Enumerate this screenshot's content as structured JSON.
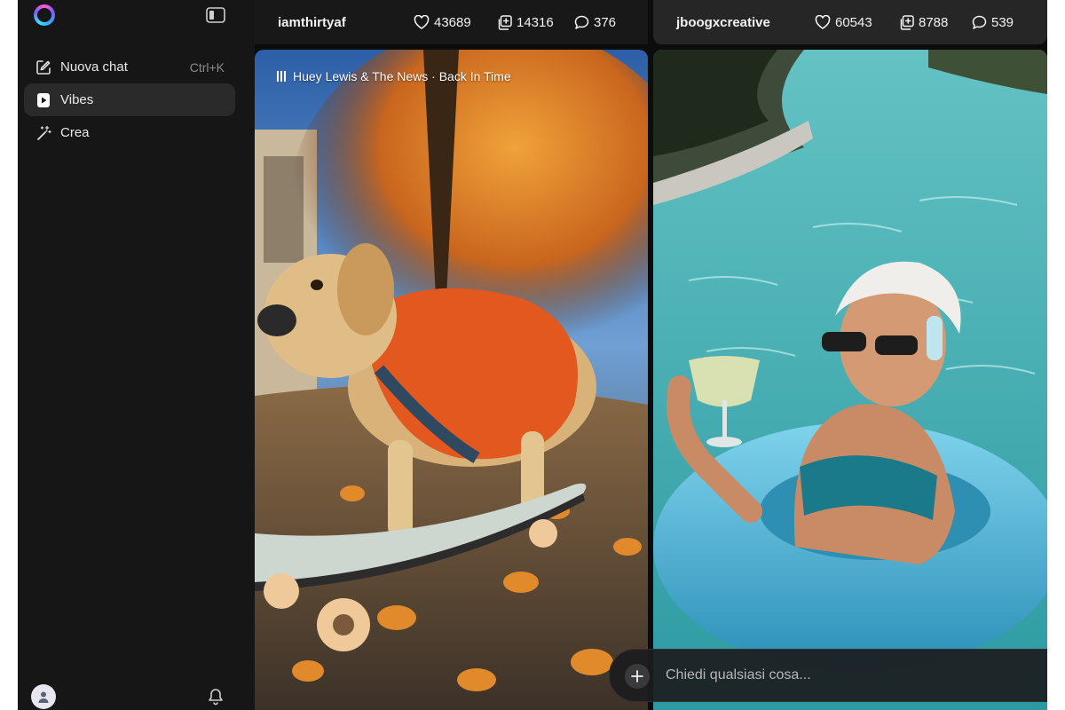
{
  "sidebar": {
    "logo_icon": "meta-ai-ring-icon",
    "collapse_icon": "sidebar-toggle-icon",
    "items": [
      {
        "label": "Nuova chat",
        "icon": "edit-icon",
        "shortcut": "Ctrl+K"
      },
      {
        "label": "Vibes",
        "icon": "play-icon",
        "active": true
      },
      {
        "label": "Crea",
        "icon": "magic-wand-icon"
      }
    ],
    "avatar_icon": "user-icon",
    "bell_icon": "bell-icon"
  },
  "feed": {
    "left_card": {
      "username": "iamthirtyaf",
      "likes": "43689",
      "remixes": "14316",
      "comments": "376",
      "music": "Huey Lewis & The News · Back In Time",
      "image": "golden retriever in red puffer vest on skateboard, autumn leaves"
    },
    "right_card": {
      "username": "jboogxcreative",
      "likes": "60543",
      "remixes": "8788",
      "comments": "539",
      "image": "elderly woman in sunglasses and headphones on blue pool float holding a drink"
    }
  },
  "composer": {
    "placeholder": "Chiedi qualsiasi cosa...",
    "plus_icon": "plus-icon",
    "mic_icon": "microphone-icon",
    "send_icon": "arrow-up-icon"
  },
  "colors": {
    "background": "#141414",
    "sidebar": "#161616",
    "active_item": "#2a2a2a",
    "send_button": "#2f4bb0"
  }
}
